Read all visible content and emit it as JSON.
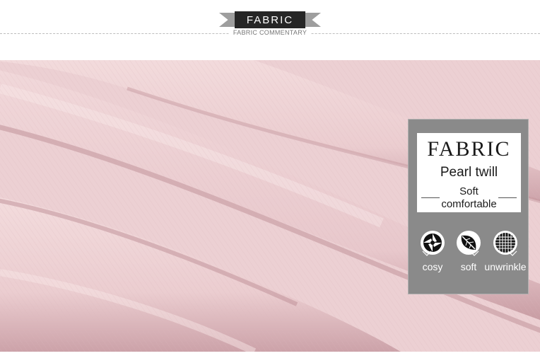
{
  "header": {
    "banner_title": "FABRIC",
    "subtitle": "FABRIC COMMENTARY"
  },
  "card": {
    "title": "FABRIC",
    "material": "Pearl twill",
    "feature_line1": "Soft",
    "feature_line2": "comfortable",
    "features": [
      {
        "icon": "aperture-icon",
        "label": "cosy"
      },
      {
        "icon": "leaf-icon",
        "label": "soft"
      },
      {
        "icon": "mesh-grid-icon",
        "label": "unwrinkle"
      }
    ]
  },
  "colors": {
    "fabric_pink": "#ecd0d3",
    "card_gray": "#8a8a8a",
    "ribbon_dark": "#262626"
  }
}
